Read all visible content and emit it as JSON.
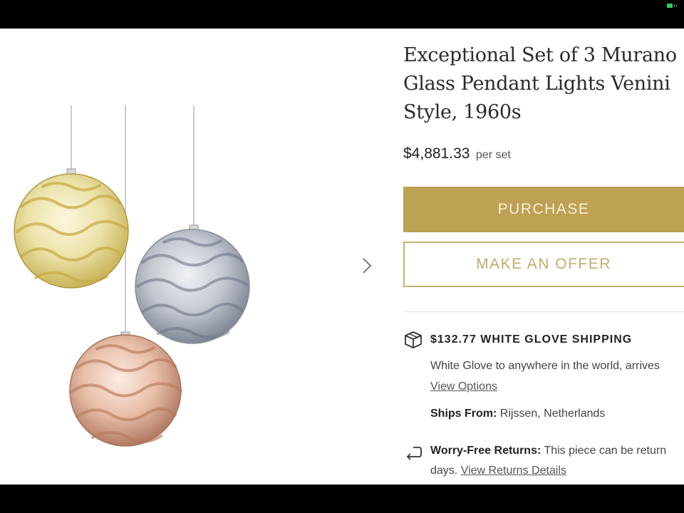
{
  "product": {
    "title": "Exceptional Set of 3 Murano Glass Pendant Lights Venini Style, 1960s",
    "price": "$4,881.33",
    "price_unit": "per set"
  },
  "actions": {
    "purchase_label": "PURCHASE",
    "offer_label": "MAKE AN OFFER"
  },
  "shipping": {
    "title": "$132.77 WHITE GLOVE SHIPPING",
    "description": "White Glove to anywhere in the world, arrives",
    "view_options_label": "View Options",
    "ships_from_label": "Ships From:",
    "ships_from_value": "Rijssen, Netherlands"
  },
  "returns": {
    "label": "Worry-Free Returns:",
    "text_line1": "This piece can be return",
    "text_line2": "days.",
    "details_link": "View Returns Details"
  },
  "icons": {
    "box": "package-icon",
    "return": "return-arrow-icon",
    "next": "chevron-right-icon"
  },
  "colors": {
    "accent": "#bea253",
    "accent_outline": "#c9b070"
  }
}
